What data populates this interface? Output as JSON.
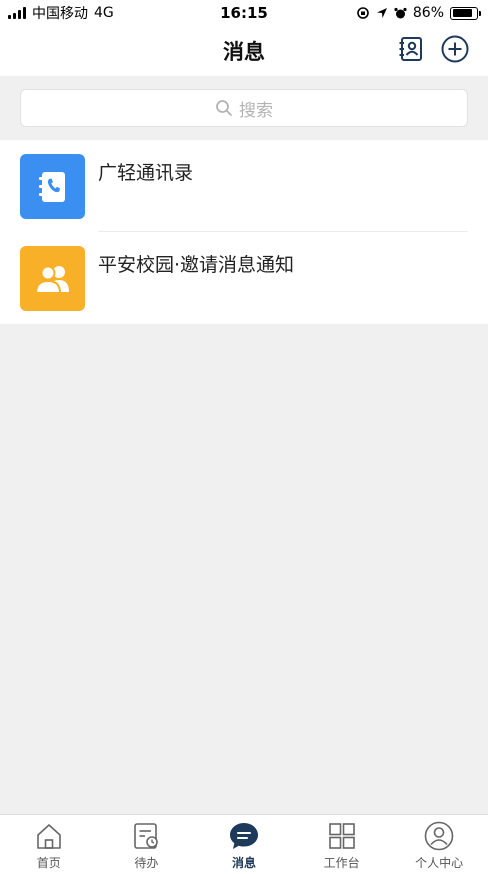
{
  "status_bar": {
    "carrier": "中国移动",
    "network": "4G",
    "time": "16:15",
    "battery": "86%",
    "battery_level": 0.86
  },
  "header": {
    "title": "消息"
  },
  "search": {
    "placeholder": "搜索"
  },
  "messages": [
    {
      "title": "广轻通讯录",
      "icon": "phone-book-icon",
      "icon_color": "#3a8ff0"
    },
    {
      "title": "平安校园·邀请消息通知",
      "icon": "people-icon",
      "icon_color": "#f7b027"
    }
  ],
  "tabs": [
    {
      "label": "首页",
      "icon": "home-icon"
    },
    {
      "label": "待办",
      "icon": "todo-icon"
    },
    {
      "label": "消息",
      "icon": "message-icon",
      "active": true
    },
    {
      "label": "工作台",
      "icon": "grid-icon"
    },
    {
      "label": "个人中心",
      "icon": "user-icon"
    }
  ],
  "colors": {
    "accent": "#1e3a5a",
    "background": "#f0f0f0"
  }
}
